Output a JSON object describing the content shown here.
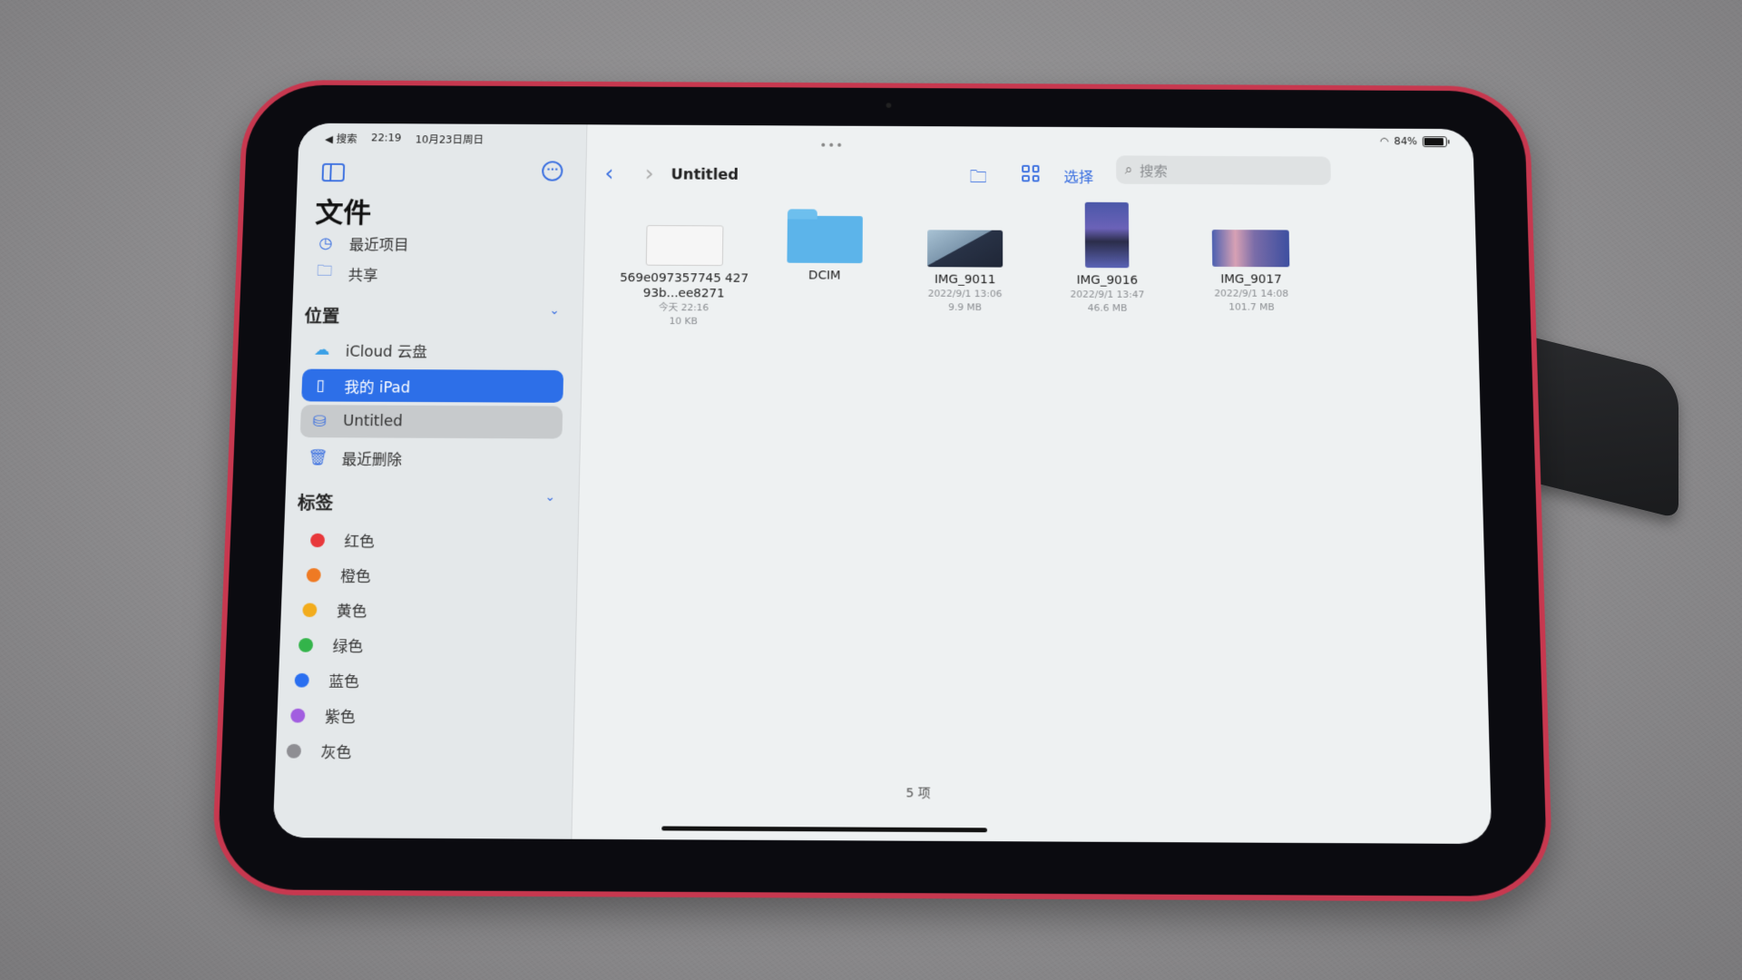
{
  "statusbar": {
    "back_app": "◀ 搜索",
    "time": "22:19",
    "date": "10月23日周日",
    "battery": "84%"
  },
  "sidebar": {
    "title": "文件",
    "more_icon": "ellipsis-circle-icon",
    "top_items": [
      {
        "label": "最近项目",
        "icon": "clock-icon"
      },
      {
        "label": "共享",
        "icon": "shared-folder-icon"
      }
    ],
    "locations_header": "位置",
    "locations": [
      {
        "label": "iCloud 云盘",
        "icon": "icloud-icon",
        "state": "normal"
      },
      {
        "label": "我的 iPad",
        "icon": "ipad-icon",
        "state": "active"
      },
      {
        "label": "Untitled",
        "icon": "external-drive-icon",
        "state": "selected"
      },
      {
        "label": "最近删除",
        "icon": "trash-icon",
        "state": "normal"
      }
    ],
    "tags_header": "标签",
    "tags": [
      {
        "label": "红色",
        "color": "#e8383b"
      },
      {
        "label": "橙色",
        "color": "#ef7a23"
      },
      {
        "label": "黄色",
        "color": "#f2ac1d"
      },
      {
        "label": "绿色",
        "color": "#33b44a"
      },
      {
        "label": "蓝色",
        "color": "#2a6ff0"
      },
      {
        "label": "紫色",
        "color": "#a25ee0"
      },
      {
        "label": "灰色",
        "color": "#8e8e93"
      }
    ]
  },
  "toolbar": {
    "grabber": "•••",
    "back": "‹",
    "forward": "›",
    "folder_title": "Untitled",
    "select_label": "选择",
    "search_placeholder": "搜索"
  },
  "files": [
    {
      "name": "569e097357745 42793b...ee8271",
      "date": "今天 22:16",
      "size": "10 KB",
      "type": "apple-file"
    },
    {
      "name": "DCIM",
      "date": "",
      "size": "",
      "type": "folder"
    },
    {
      "name": "IMG_9011",
      "date": "2022/9/1 13:06",
      "size": "9.9 MB",
      "type": "image"
    },
    {
      "name": "IMG_9016",
      "date": "2022/9/1 13:47",
      "size": "46.6 MB",
      "type": "image"
    },
    {
      "name": "IMG_9017",
      "date": "2022/9/1 14:08",
      "size": "101.7 MB",
      "type": "image"
    }
  ],
  "footer": {
    "item_count": "5 项"
  },
  "colors": {
    "accent": "#2d6fe8",
    "device": "#c7384f"
  }
}
